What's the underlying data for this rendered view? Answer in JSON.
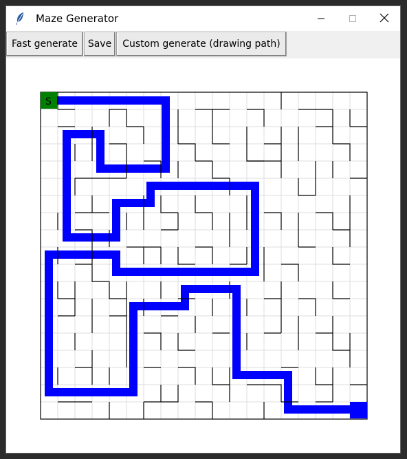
{
  "window": {
    "title": "Maze Generator",
    "controls": [
      "minimize-icon",
      "maximize-icon",
      "close-icon"
    ]
  },
  "toolbar": {
    "fast_generate_label": "Fast generate",
    "save_label": "Save",
    "custom_generate_label": "Custom generate (drawing path)"
  },
  "maze": {
    "start_label": "S",
    "grid_size": 19,
    "colors": {
      "path": "#0000ff",
      "start": "#008000",
      "end": "#0000ff",
      "walls": "#000000",
      "grid": "#dcdcdc",
      "background": "#ffffff"
    }
  }
}
